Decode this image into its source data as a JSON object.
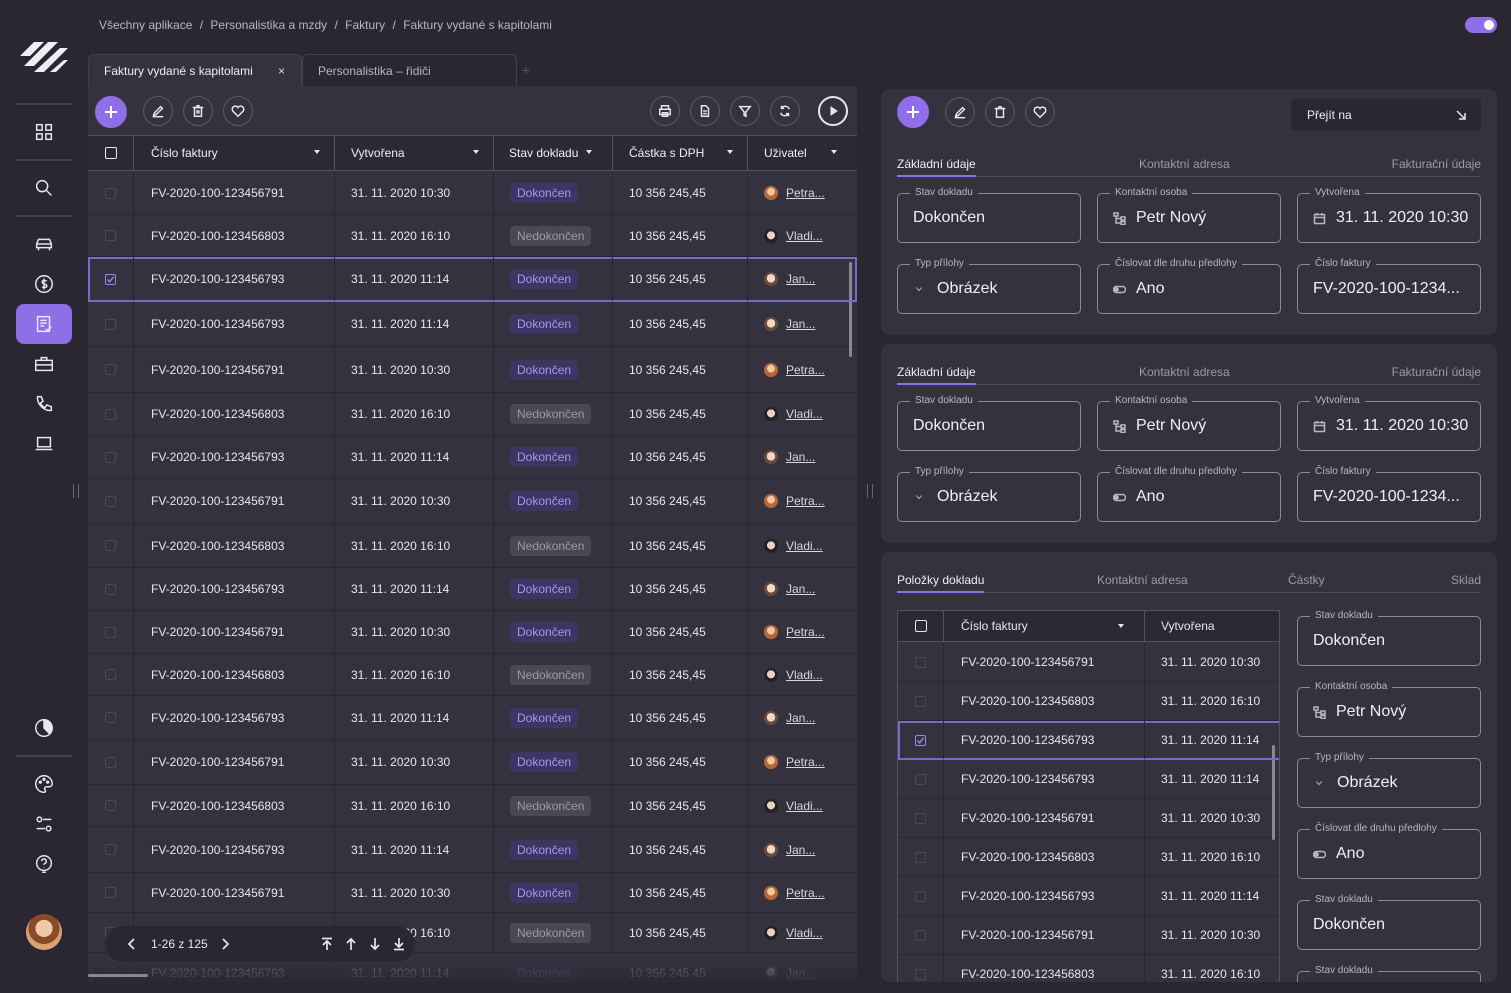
{
  "breadcrumb": [
    "Všechny aplikace",
    "/",
    "Personalistika a mzdy",
    "/",
    "Faktury",
    "/",
    "Faktury vydané s kapitolami"
  ],
  "tabs": [
    {
      "label": "Faktury vydané s kapitolami",
      "active": true
    },
    {
      "label": "Personalistika – řidiči",
      "active": false
    }
  ],
  "close_symbol": "×",
  "plus_symbol": "+",
  "sidebar_icons": [
    "apps-grid-icon",
    "search-icon",
    "car-icon",
    "dollar-icon",
    "invoice-icon",
    "briefcase-icon",
    "phone-icon",
    "laptop-icon",
    "theme-icon",
    "palette-icon",
    "settings-icon",
    "help-icon"
  ],
  "table": {
    "columns": [
      "Číslo faktury",
      "Vytvořena",
      "Stav dokladu",
      "Částka s DPH",
      "Uživatel"
    ],
    "rows": [
      {
        "cislo": "FV-2020-100-123456791",
        "vytvorena": "31. 11. 2020 10:30",
        "stav": "Dokončen",
        "castka": "10 356 245,45",
        "user": "Petra..."
      },
      {
        "cislo": "FV-2020-100-123456803",
        "vytvorena": "31. 11. 2020 16:10",
        "stav": "Nedokončen",
        "castka": "10 356 245,45",
        "user": "Vladi..."
      },
      {
        "cislo": "FV-2020-100-123456793",
        "vytvorena": "31. 11. 2020 11:14",
        "stav": "Dokončen",
        "castka": "10 356 245,45",
        "user": "Jan..."
      },
      {
        "cislo": "FV-2020-100-123456793",
        "vytvorena": "31. 11. 2020 11:14",
        "stav": "Dokončen",
        "castka": "10 356 245,45",
        "user": "Jan..."
      },
      {
        "cislo": "FV-2020-100-123456791",
        "vytvorena": "31. 11. 2020 10:30",
        "stav": "Dokončen",
        "castka": "10 356 245,45",
        "user": "Petra..."
      },
      {
        "cislo": "FV-2020-100-123456803",
        "vytvorena": "31. 11. 2020 16:10",
        "stav": "Nedokončen",
        "castka": "10 356 245,45",
        "user": "Vladi..."
      },
      {
        "cislo": "FV-2020-100-123456793",
        "vytvorena": "31. 11. 2020 11:14",
        "stav": "Dokončen",
        "castka": "10 356 245,45",
        "user": "Jan..."
      },
      {
        "cislo": "FV-2020-100-123456791",
        "vytvorena": "31. 11. 2020 10:30",
        "stav": "Dokončen",
        "castka": "10 356 245,45",
        "user": "Petra..."
      },
      {
        "cislo": "FV-2020-100-123456803",
        "vytvorena": "31. 11. 2020 16:10",
        "stav": "Nedokončen",
        "castka": "10 356 245,45",
        "user": "Vladi..."
      },
      {
        "cislo": "FV-2020-100-123456793",
        "vytvorena": "31. 11. 2020 11:14",
        "stav": "Dokončen",
        "castka": "10 356 245,45",
        "user": "Jan..."
      },
      {
        "cislo": "FV-2020-100-123456791",
        "vytvorena": "31. 11. 2020 10:30",
        "stav": "Dokončen",
        "castka": "10 356 245,45",
        "user": "Petra..."
      },
      {
        "cislo": "FV-2020-100-123456803",
        "vytvorena": "31. 11. 2020 16:10",
        "stav": "Nedokončen",
        "castka": "10 356 245,45",
        "user": "Vladi..."
      },
      {
        "cislo": "FV-2020-100-123456793",
        "vytvorena": "31. 11. 2020 11:14",
        "stav": "Dokončen",
        "castka": "10 356 245,45",
        "user": "Jan..."
      },
      {
        "cislo": "FV-2020-100-123456791",
        "vytvorena": "31. 11. 2020 10:30",
        "stav": "Dokončen",
        "castka": "10 356 245,45",
        "user": "Petra..."
      },
      {
        "cislo": "FV-2020-100-123456803",
        "vytvorena": "31. 11. 2020 16:10",
        "stav": "Nedokončen",
        "castka": "10 356 245,45",
        "user": "Vladi..."
      },
      {
        "cislo": "FV-2020-100-123456793",
        "vytvorena": "31. 11. 2020 11:14",
        "stav": "Dokončen",
        "castka": "10 356 245,45",
        "user": "Jan..."
      },
      {
        "cislo": "FV-2020-100-123456791",
        "vytvorena": "31. 11. 2020 10:30",
        "stav": "Dokončen",
        "castka": "10 356 245,45",
        "user": "Petra..."
      },
      {
        "cislo": "FV-2020-100-123456803",
        "vytvorena": "31. 11. 2020 16:10",
        "stav": "Nedokončen",
        "castka": "10 356 245,45",
        "user": "Vladi..."
      },
      {
        "cislo": "FV-2020-100-123456793",
        "vytvorena": "31. 11. 2020 11:14",
        "stav": "Dokončen",
        "castka": "10 356 245,45",
        "user": "Jan..."
      }
    ],
    "selected_index": 2
  },
  "pager": {
    "range": "1-26 z 125"
  },
  "goto": {
    "label": "Přejít na"
  },
  "form_cards": [
    {
      "tabs": [
        "Základní údaje",
        "Kontaktní adresa",
        "Fakturační údaje"
      ],
      "fields": [
        {
          "label": "Stav dokladu",
          "value": "Dokončen",
          "icon": ""
        },
        {
          "label": "Kontaktní osoba",
          "value": "Petr Nový",
          "icon": "org-chart-icon"
        },
        {
          "label": "Vytvořena",
          "value": "31. 11. 2020 10:30",
          "icon": "calendar-icon"
        },
        {
          "label": "Typ přílohy",
          "value": "Obrázek",
          "icon": "chevron-down-icon"
        },
        {
          "label": "Číslovat dle druhu předlohy",
          "value": "Ano",
          "icon": "toggle-icon"
        },
        {
          "label": "Číslo faktury",
          "value": "FV-2020-100-1234...",
          "icon": ""
        }
      ]
    },
    {
      "tabs": [
        "Základní údaje",
        "Kontaktní adresa",
        "Fakturační údaje"
      ],
      "fields": [
        {
          "label": "Stav dokladu",
          "value": "Dokončen",
          "icon": ""
        },
        {
          "label": "Kontaktní osoba",
          "value": "Petr Nový",
          "icon": "org-chart-icon"
        },
        {
          "label": "Vytvořena",
          "value": "31. 11. 2020 10:30",
          "icon": "calendar-icon"
        },
        {
          "label": "Typ přílohy",
          "value": "Obrázek",
          "icon": "chevron-down-icon"
        },
        {
          "label": "Číslovat dle druhu předlohy",
          "value": "Ano",
          "icon": "toggle-icon"
        },
        {
          "label": "Číslo faktury",
          "value": "FV-2020-100-1234...",
          "icon": ""
        }
      ]
    }
  ],
  "items_card": {
    "tabs": [
      "Položky dokladu",
      "Kontaktní adresa",
      "Částky",
      "Sklad"
    ],
    "columns": [
      "Číslo faktury",
      "Vytvořena"
    ],
    "rows": [
      {
        "cislo": "FV-2020-100-123456791",
        "vytvorena": "31. 11. 2020 10:30"
      },
      {
        "cislo": "FV-2020-100-123456803",
        "vytvorena": "31. 11. 2020 16:10"
      },
      {
        "cislo": "FV-2020-100-123456793",
        "vytvorena": "31. 11. 2020 11:14"
      },
      {
        "cislo": "FV-2020-100-123456793",
        "vytvorena": "31. 11. 2020 11:14"
      },
      {
        "cislo": "FV-2020-100-123456791",
        "vytvorena": "31. 11. 2020 10:30"
      },
      {
        "cislo": "FV-2020-100-123456803",
        "vytvorena": "31. 11. 2020 16:10"
      },
      {
        "cislo": "FV-2020-100-123456793",
        "vytvorena": "31. 11. 2020 11:14"
      },
      {
        "cislo": "FV-2020-100-123456791",
        "vytvorena": "31. 11. 2020 10:30"
      },
      {
        "cislo": "FV-2020-100-123456803",
        "vytvorena": "31. 11. 2020 16:10"
      }
    ],
    "selected_index": 2,
    "side_fields": [
      {
        "label": "Stav dokladu",
        "value": "Dokončen",
        "icon": ""
      },
      {
        "label": "Kontaktní osoba",
        "value": "Petr Nový",
        "icon": "org-chart-icon"
      },
      {
        "label": "Typ přílohy",
        "value": "Obrázek",
        "icon": "chevron-down-icon"
      },
      {
        "label": "Číslovat dle druhu předlohy",
        "value": "Ano",
        "icon": "toggle-icon"
      },
      {
        "label": "Stav dokladu",
        "value": "Dokončen",
        "icon": ""
      },
      {
        "label": "Stav dokladu",
        "value": "",
        "icon": ""
      }
    ]
  },
  "colors": {
    "accent": "#8f6fe8",
    "done_badge": "#3d3562",
    "undone_badge": "#4b4855",
    "bg": "#2a2733",
    "panel": "#35323f"
  }
}
